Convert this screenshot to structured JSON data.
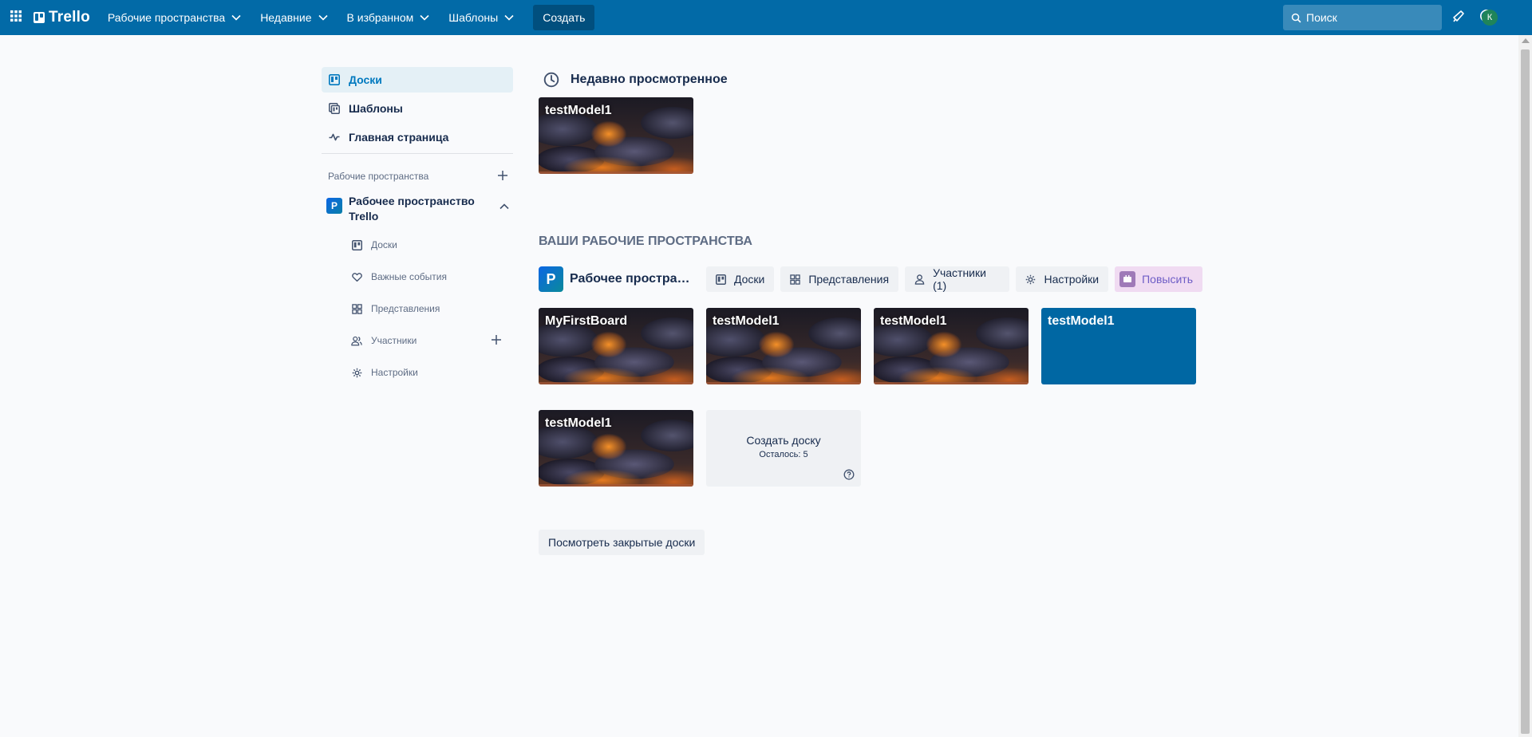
{
  "header": {
    "logo": "Trello",
    "nav": [
      {
        "label": "Рабочие пространства"
      },
      {
        "label": "Недавние"
      },
      {
        "label": "В избранном"
      },
      {
        "label": "Шаблоны"
      }
    ],
    "create_label": "Создать",
    "search_placeholder": "Поиск",
    "avatar_initial": "К",
    "colors": {
      "bar": "#026aa7",
      "create": "#014f7e",
      "avatar": "#1f845a"
    }
  },
  "sidebar": {
    "items": [
      {
        "label": "Доски",
        "icon": "board-icon",
        "active": true
      },
      {
        "label": "Шаблоны",
        "icon": "template-icon"
      },
      {
        "label": "Главная страница",
        "icon": "activity-icon"
      }
    ],
    "workspaces_heading": "Рабочие пространства",
    "workspace": {
      "badge": "Р",
      "name": "Рабочее пространство Trello",
      "sub_items": [
        {
          "label": "Доски",
          "icon": "board-icon"
        },
        {
          "label": "Важные события",
          "icon": "heart-icon"
        },
        {
          "label": "Представления",
          "icon": "grid-icon"
        },
        {
          "label": "Участники",
          "icon": "members-icon"
        },
        {
          "label": "Настройки",
          "icon": "gear-icon"
        }
      ]
    }
  },
  "recent": {
    "title": "Недавно просмотренное",
    "boards": [
      {
        "title": "testModel1"
      }
    ]
  },
  "workspaces_section": {
    "title": "ВАШИ РАБОЧИЕ ПРОСТРАНСТВА",
    "workspace_badge": "Р",
    "workspace_name": "Рабочее пространство Trello",
    "buttons": {
      "boards": "Доски",
      "views": "Представления",
      "members": "Участники (1)",
      "settings": "Настройки",
      "upgrade": "Повысить"
    },
    "boards": [
      {
        "title": "MyFirstBoard"
      },
      {
        "title": "testModel1"
      },
      {
        "title": "testModel1"
      },
      {
        "title": "testModel1",
        "color": "#0067a3"
      },
      {
        "title": "testModel1"
      }
    ],
    "create_board": {
      "label": "Создать доску",
      "remaining": "Осталось: 5"
    },
    "closed_boards": "Посмотреть закрытые доски"
  }
}
